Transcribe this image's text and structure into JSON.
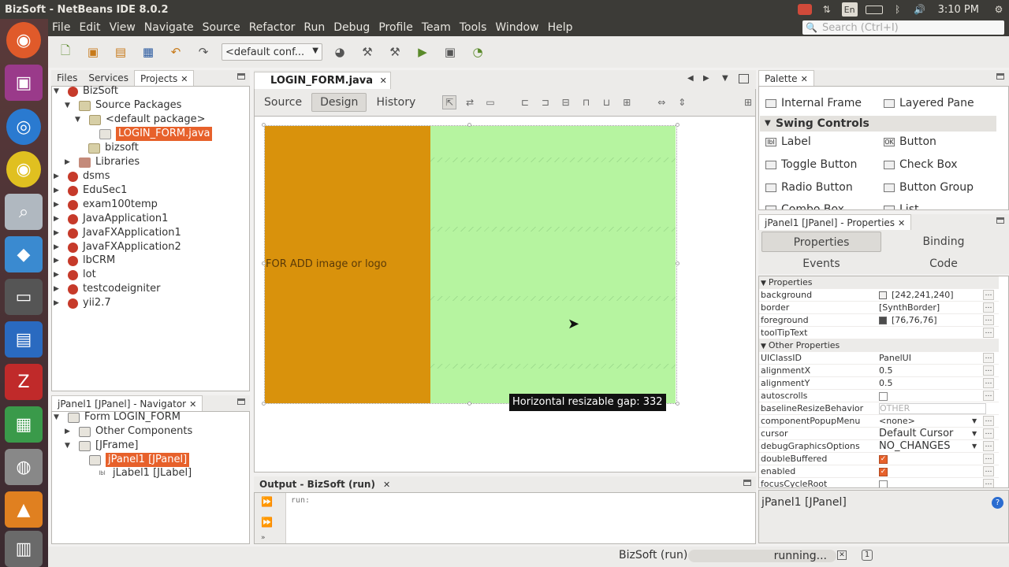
{
  "window": {
    "title": "BizSoft - NetBeans IDE 8.0.2"
  },
  "topbar": {
    "clock": "3:10 PM",
    "lang": "En"
  },
  "menu": [
    "File",
    "Edit",
    "View",
    "Navigate",
    "Source",
    "Refactor",
    "Run",
    "Debug",
    "Profile",
    "Team",
    "Tools",
    "Window",
    "Help"
  ],
  "search": {
    "placeholder": "Search (Ctrl+I)"
  },
  "toolbar": {
    "config": "<default conf..."
  },
  "projects_panel": {
    "tabs": [
      "Files",
      "Services",
      "Projects"
    ],
    "tree": [
      {
        "label": "BizSoft"
      },
      {
        "label": "Source Packages"
      },
      {
        "label": "<default package>"
      },
      {
        "label": "LOGIN_FORM.java"
      },
      {
        "label": "bizsoft"
      },
      {
        "label": "Libraries"
      },
      {
        "label": "dsms"
      },
      {
        "label": "EduSec1"
      },
      {
        "label": "exam100temp"
      },
      {
        "label": "JavaApplication1"
      },
      {
        "label": "JavaFXApplication1"
      },
      {
        "label": "JavaFXApplication2"
      },
      {
        "label": "lbCRM"
      },
      {
        "label": "lot"
      },
      {
        "label": "testcodeigniter"
      },
      {
        "label": "yii2.7"
      }
    ]
  },
  "navigator": {
    "title": "jPanel1 [JPanel] - Navigator",
    "tree": [
      "Form LOGIN_FORM",
      "Other Components",
      "[JFrame]",
      "jPanel1 [JPanel]",
      "jLabel1 [JLabel]"
    ]
  },
  "editor": {
    "tab": "LOGIN_FORM.java",
    "subtabs": [
      "Source",
      "Design",
      "History"
    ],
    "label_text": "FOR ADD image or logo",
    "tooltip": "Horizontal resizable gap: 332",
    "colors": {
      "left_panel": "#d9920c",
      "right_panel": "#b6f4a0"
    }
  },
  "output": {
    "title": "Output - BizSoft (run)",
    "text": "run:"
  },
  "palette": {
    "title": "Palette",
    "items_top": [
      "Internal Frame",
      "Layered Pane"
    ],
    "category": "Swing Controls",
    "items": [
      "Label",
      "Button",
      "Toggle Button",
      "Check Box",
      "Radio Button",
      "Button Group",
      "Combo Box",
      "List"
    ]
  },
  "properties": {
    "title": "jPanel1 [JPanel] - Properties",
    "tabs": [
      "Properties",
      "Binding",
      "Events",
      "Code"
    ],
    "cat1": "Properties",
    "cat2": "Other Properties",
    "rows": [
      {
        "name": "background",
        "value": "[242,241,240]"
      },
      {
        "name": "border",
        "value": "[SynthBorder]"
      },
      {
        "name": "foreground",
        "value": "[76,76,76]"
      },
      {
        "name": "toolTipText",
        "value": ""
      },
      {
        "name": "UIClassID",
        "value": "PanelUI"
      },
      {
        "name": "alignmentX",
        "value": "0.5"
      },
      {
        "name": "alignmentY",
        "value": "0.5"
      },
      {
        "name": "autoscrolls",
        "value": ""
      },
      {
        "name": "baselineResizeBehavior",
        "value": "OTHER"
      },
      {
        "name": "componentPopupMenu",
        "value": "<none>"
      },
      {
        "name": "cursor",
        "value": "Default Cursor"
      },
      {
        "name": "debugGraphicsOptions",
        "value": "NO_CHANGES"
      },
      {
        "name": "doubleBuffered",
        "value": ""
      },
      {
        "name": "enabled",
        "value": ""
      },
      {
        "name": "focusCycleRoot",
        "value": ""
      }
    ],
    "description": "jPanel1 [JPanel]"
  },
  "status": {
    "project": "BizSoft (run)",
    "progress": "running..."
  }
}
